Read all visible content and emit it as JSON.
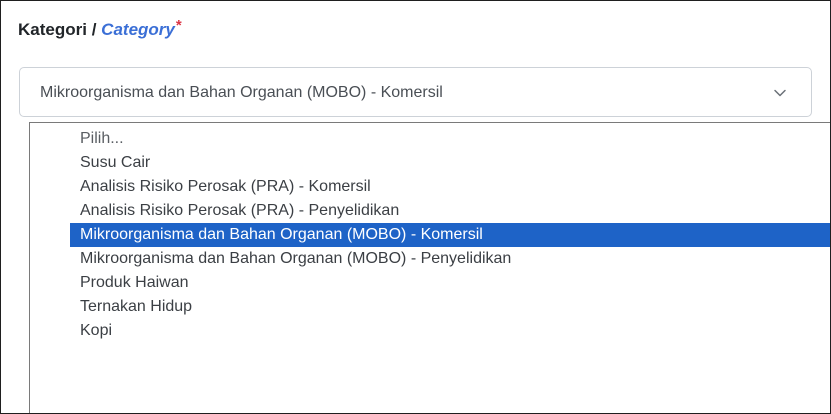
{
  "field": {
    "label_ms": "Kategori",
    "label_separator": "/",
    "label_en": "Category",
    "required_marker": "*"
  },
  "select": {
    "value": "Mikroorganisma dan Bahan Organan (MOBO) - Komersil",
    "icon": "chevron-down-icon"
  },
  "dropdown": {
    "options": [
      {
        "label": "Pilih..."
      },
      {
        "label": "Susu Cair"
      },
      {
        "label": "Analisis Risiko Perosak (PRA) - Komersil"
      },
      {
        "label": "Analisis Risiko Perosak (PRA) - Penyelidikan"
      },
      {
        "label": "Mikroorganisma dan Bahan Organan (MOBO) - Komersil"
      },
      {
        "label": "Mikroorganisma dan Bahan Organan (MOBO) - Penyelidikan"
      },
      {
        "label": "Produk Haiwan"
      },
      {
        "label": "Ternakan Hidup"
      },
      {
        "label": "Kopi"
      }
    ],
    "selected_index": 4
  },
  "colors": {
    "accent": "#1e63c7",
    "label_en": "#3b6fd6",
    "required": "#dc3545"
  }
}
